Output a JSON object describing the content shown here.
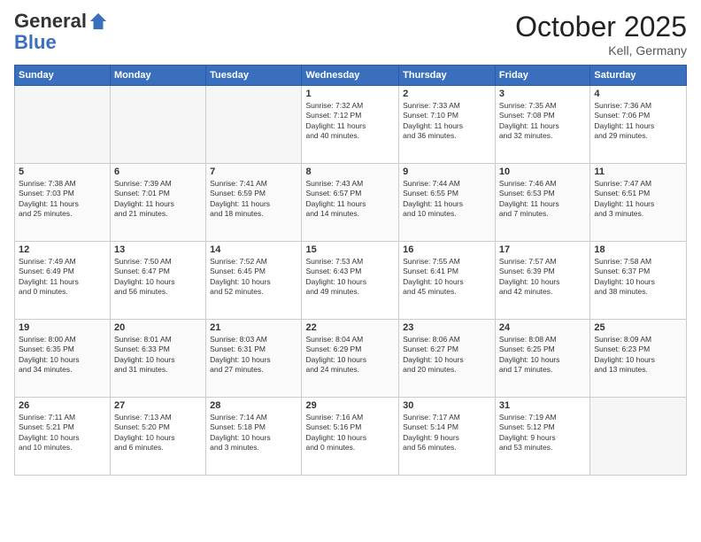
{
  "header": {
    "logo_general": "General",
    "logo_blue": "Blue",
    "month": "October 2025",
    "location": "Kell, Germany"
  },
  "weekdays": [
    "Sunday",
    "Monday",
    "Tuesday",
    "Wednesday",
    "Thursday",
    "Friday",
    "Saturday"
  ],
  "weeks": [
    [
      {
        "day": "",
        "info": ""
      },
      {
        "day": "",
        "info": ""
      },
      {
        "day": "",
        "info": ""
      },
      {
        "day": "1",
        "info": "Sunrise: 7:32 AM\nSunset: 7:12 PM\nDaylight: 11 hours\nand 40 minutes."
      },
      {
        "day": "2",
        "info": "Sunrise: 7:33 AM\nSunset: 7:10 PM\nDaylight: 11 hours\nand 36 minutes."
      },
      {
        "day": "3",
        "info": "Sunrise: 7:35 AM\nSunset: 7:08 PM\nDaylight: 11 hours\nand 32 minutes."
      },
      {
        "day": "4",
        "info": "Sunrise: 7:36 AM\nSunset: 7:06 PM\nDaylight: 11 hours\nand 29 minutes."
      }
    ],
    [
      {
        "day": "5",
        "info": "Sunrise: 7:38 AM\nSunset: 7:03 PM\nDaylight: 11 hours\nand 25 minutes."
      },
      {
        "day": "6",
        "info": "Sunrise: 7:39 AM\nSunset: 7:01 PM\nDaylight: 11 hours\nand 21 minutes."
      },
      {
        "day": "7",
        "info": "Sunrise: 7:41 AM\nSunset: 6:59 PM\nDaylight: 11 hours\nand 18 minutes."
      },
      {
        "day": "8",
        "info": "Sunrise: 7:43 AM\nSunset: 6:57 PM\nDaylight: 11 hours\nand 14 minutes."
      },
      {
        "day": "9",
        "info": "Sunrise: 7:44 AM\nSunset: 6:55 PM\nDaylight: 11 hours\nand 10 minutes."
      },
      {
        "day": "10",
        "info": "Sunrise: 7:46 AM\nSunset: 6:53 PM\nDaylight: 11 hours\nand 7 minutes."
      },
      {
        "day": "11",
        "info": "Sunrise: 7:47 AM\nSunset: 6:51 PM\nDaylight: 11 hours\nand 3 minutes."
      }
    ],
    [
      {
        "day": "12",
        "info": "Sunrise: 7:49 AM\nSunset: 6:49 PM\nDaylight: 11 hours\nand 0 minutes."
      },
      {
        "day": "13",
        "info": "Sunrise: 7:50 AM\nSunset: 6:47 PM\nDaylight: 10 hours\nand 56 minutes."
      },
      {
        "day": "14",
        "info": "Sunrise: 7:52 AM\nSunset: 6:45 PM\nDaylight: 10 hours\nand 52 minutes."
      },
      {
        "day": "15",
        "info": "Sunrise: 7:53 AM\nSunset: 6:43 PM\nDaylight: 10 hours\nand 49 minutes."
      },
      {
        "day": "16",
        "info": "Sunrise: 7:55 AM\nSunset: 6:41 PM\nDaylight: 10 hours\nand 45 minutes."
      },
      {
        "day": "17",
        "info": "Sunrise: 7:57 AM\nSunset: 6:39 PM\nDaylight: 10 hours\nand 42 minutes."
      },
      {
        "day": "18",
        "info": "Sunrise: 7:58 AM\nSunset: 6:37 PM\nDaylight: 10 hours\nand 38 minutes."
      }
    ],
    [
      {
        "day": "19",
        "info": "Sunrise: 8:00 AM\nSunset: 6:35 PM\nDaylight: 10 hours\nand 34 minutes."
      },
      {
        "day": "20",
        "info": "Sunrise: 8:01 AM\nSunset: 6:33 PM\nDaylight: 10 hours\nand 31 minutes."
      },
      {
        "day": "21",
        "info": "Sunrise: 8:03 AM\nSunset: 6:31 PM\nDaylight: 10 hours\nand 27 minutes."
      },
      {
        "day": "22",
        "info": "Sunrise: 8:04 AM\nSunset: 6:29 PM\nDaylight: 10 hours\nand 24 minutes."
      },
      {
        "day": "23",
        "info": "Sunrise: 8:06 AM\nSunset: 6:27 PM\nDaylight: 10 hours\nand 20 minutes."
      },
      {
        "day": "24",
        "info": "Sunrise: 8:08 AM\nSunset: 6:25 PM\nDaylight: 10 hours\nand 17 minutes."
      },
      {
        "day": "25",
        "info": "Sunrise: 8:09 AM\nSunset: 6:23 PM\nDaylight: 10 hours\nand 13 minutes."
      }
    ],
    [
      {
        "day": "26",
        "info": "Sunrise: 7:11 AM\nSunset: 5:21 PM\nDaylight: 10 hours\nand 10 minutes."
      },
      {
        "day": "27",
        "info": "Sunrise: 7:13 AM\nSunset: 5:20 PM\nDaylight: 10 hours\nand 6 minutes."
      },
      {
        "day": "28",
        "info": "Sunrise: 7:14 AM\nSunset: 5:18 PM\nDaylight: 10 hours\nand 3 minutes."
      },
      {
        "day": "29",
        "info": "Sunrise: 7:16 AM\nSunset: 5:16 PM\nDaylight: 10 hours\nand 0 minutes."
      },
      {
        "day": "30",
        "info": "Sunrise: 7:17 AM\nSunset: 5:14 PM\nDaylight: 9 hours\nand 56 minutes."
      },
      {
        "day": "31",
        "info": "Sunrise: 7:19 AM\nSunset: 5:12 PM\nDaylight: 9 hours\nand 53 minutes."
      },
      {
        "day": "",
        "info": ""
      }
    ]
  ]
}
